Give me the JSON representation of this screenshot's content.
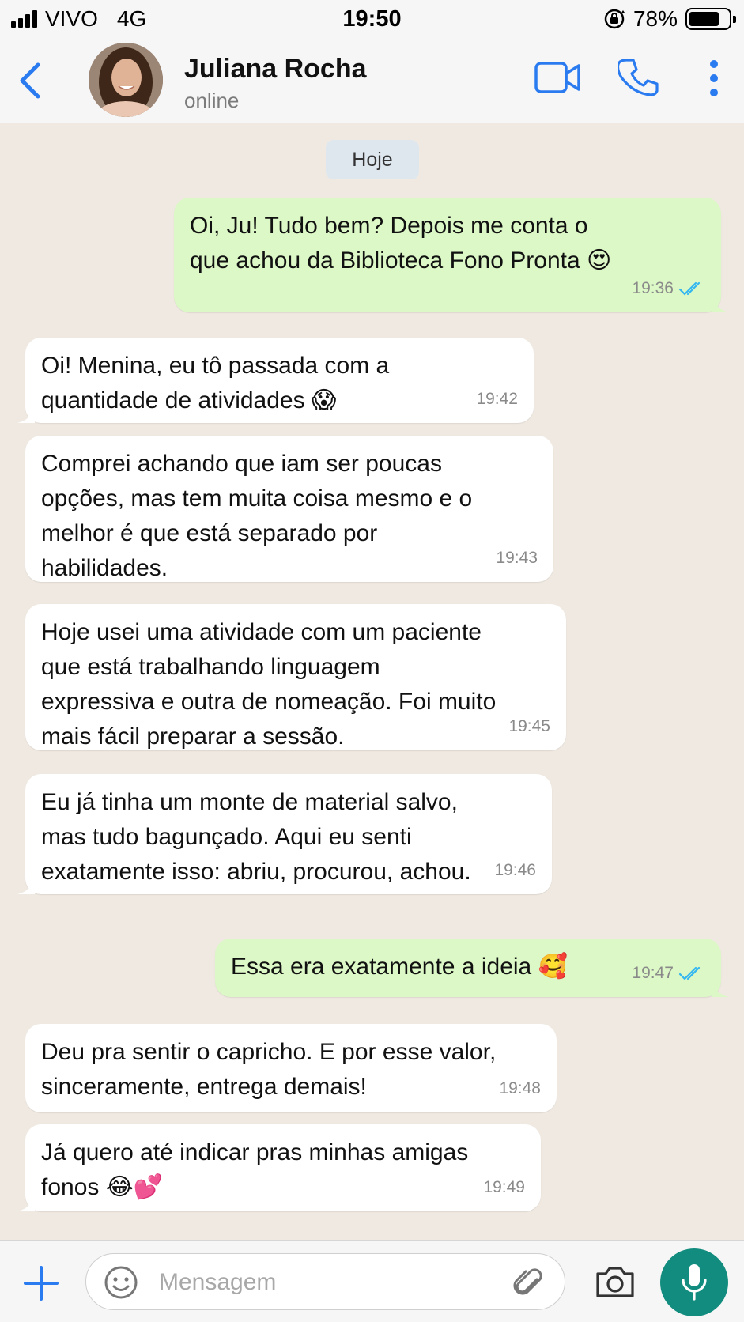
{
  "status_bar": {
    "carrier": "VIVO",
    "network": "4G",
    "time": "19:50",
    "battery": "78%",
    "battery_level": 0.78
  },
  "header": {
    "contact_name": "Juliana Rocha",
    "contact_status": "online",
    "icons": [
      "back-icon",
      "video-call-icon",
      "phone-icon",
      "more-options-icon"
    ]
  },
  "chat": {
    "date_label": "Hoje",
    "messages": [
      {
        "direction": "out",
        "text": "Oi, Ju! Tudo bem? Depois me conta o\nque achou da Biblioteca Fono Pronta 😍",
        "time": "19:36",
        "read": true
      },
      {
        "direction": "in",
        "text": "Oi! Menina, eu tô passada com a\nquantidade de atividades 😱",
        "time": "19:42"
      },
      {
        "direction": "in",
        "text": "Comprei achando que iam ser poucas\nopções, mas tem muita coisa mesmo e o\nmelhor é que está separado por\nhabilidades.",
        "time": "19:43"
      },
      {
        "direction": "in",
        "text": "Hoje usei uma atividade com um paciente\nque está trabalhando linguagem\nexpressiva e outra de nomeação. Foi muito\nmais fácil preparar a sessão.",
        "time": "19:45"
      },
      {
        "direction": "in",
        "text": "Eu já tinha um monte de material salvo,\nmas tudo bagunçado. Aqui eu senti\nexatamente isso: abriu, procurou, achou.",
        "time": "19:46"
      },
      {
        "direction": "out",
        "text": "Essa era exatamente a ideia 🥰",
        "time": "19:47",
        "read": true
      },
      {
        "direction": "in",
        "text": "Deu pra sentir o capricho. E por esse valor,\nsinceramente, entrega demais!",
        "time": "19:48"
      },
      {
        "direction": "in",
        "text": "Já quero até indicar pras minhas amigas\nfonos 😂💕",
        "time": "19:49"
      }
    ]
  },
  "input_bar": {
    "placeholder": "Mensagem",
    "value": "",
    "icons": [
      "plus-icon",
      "sticker-icon",
      "attach-icon",
      "camera-icon",
      "mic-icon"
    ]
  },
  "colors": {
    "accent": "#2b7bf0",
    "outgoing_bubble": "#dcf8c6",
    "incoming_bubble": "#ffffff",
    "chat_background": "#efe9e1",
    "read_ticks": "#34b7f1",
    "mic_button": "#128c7e"
  }
}
